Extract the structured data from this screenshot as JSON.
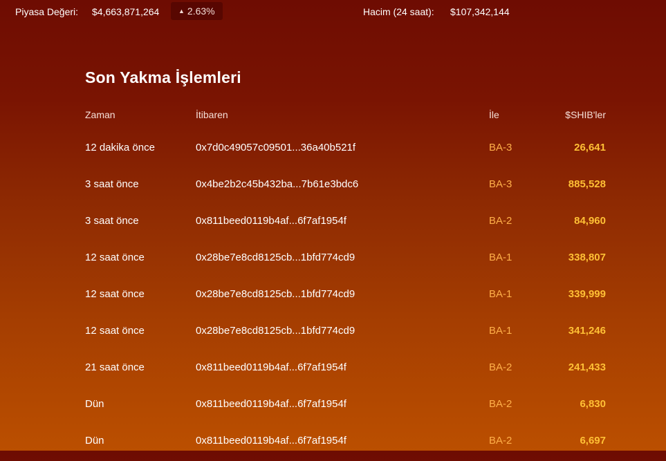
{
  "stats": {
    "market_cap_label": "Piyasa Değeri:",
    "market_cap_value": "$4,663,871,264",
    "change_arrow": "▲",
    "change_value": "2.63%",
    "volume_label": "Hacim (24 saat):",
    "volume_value": "$107,342,144"
  },
  "burns": {
    "title": "Son Yakma İşlemleri",
    "columns": {
      "time": "Zaman",
      "from": "İtibaren",
      "to": "İle",
      "amount": "$SHIB'ler"
    },
    "rows": [
      {
        "time": "12 dakika önce",
        "from": "0x7d0c49057c09501...36a40b521f",
        "to": "BA-3",
        "amount": "26,641"
      },
      {
        "time": "3 saat önce",
        "from": "0x4be2b2c45b432ba...7b61e3bdc6",
        "to": "BA-3",
        "amount": "885,528"
      },
      {
        "time": "3 saat önce",
        "from": "0x811beed0119b4af...6f7af1954f",
        "to": "BA-2",
        "amount": "84,960"
      },
      {
        "time": "12 saat önce",
        "from": "0x28be7e8cd8125cb...1bfd774cd9",
        "to": "BA-1",
        "amount": "338,807"
      },
      {
        "time": "12 saat önce",
        "from": "0x28be7e8cd8125cb...1bfd774cd9",
        "to": "BA-1",
        "amount": "339,999"
      },
      {
        "time": "12 saat önce",
        "from": "0x28be7e8cd8125cb...1bfd774cd9",
        "to": "BA-1",
        "amount": "341,246"
      },
      {
        "time": "21 saat önce",
        "from": "0x811beed0119b4af...6f7af1954f",
        "to": "BA-2",
        "amount": "241,433"
      },
      {
        "time": "Dün",
        "from": "0x811beed0119b4af...6f7af1954f",
        "to": "BA-2",
        "amount": "6,830"
      },
      {
        "time": "Dün",
        "from": "0x811beed0119b4af...6f7af1954f",
        "to": "BA-2",
        "amount": "6,697"
      }
    ]
  },
  "colors": {
    "background_top": "#6e0c02",
    "background_bottom": "#bb4f00",
    "address_accent": "#ffb04a",
    "amount_accent": "#ffc035"
  }
}
